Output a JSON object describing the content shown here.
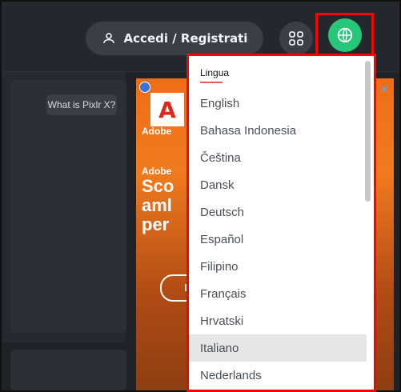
{
  "header": {
    "login_label": "Accedi / Registrati"
  },
  "left_panel": {
    "what_is_label": "What is Pixlr X?"
  },
  "ad": {
    "brand_top": "Adobe",
    "brand_mid": "Adobe",
    "headline": "Sco\naml\nper",
    "cta": "Is",
    "logo_letter": "A",
    "close": "✕"
  },
  "language_menu": {
    "title": "Lingua",
    "items": [
      {
        "label": "English"
      },
      {
        "label": "Bahasa Indonesia"
      },
      {
        "label": "Čeština"
      },
      {
        "label": "Dansk"
      },
      {
        "label": "Deutsch"
      },
      {
        "label": "Español"
      },
      {
        "label": "Filipino"
      },
      {
        "label": "Français"
      },
      {
        "label": "Hrvatski"
      },
      {
        "label": "Italiano",
        "selected": true
      },
      {
        "label": "Nederlands"
      }
    ]
  },
  "colors": {
    "accent_green": "#27c77a",
    "highlight_red": "#ff0000"
  }
}
